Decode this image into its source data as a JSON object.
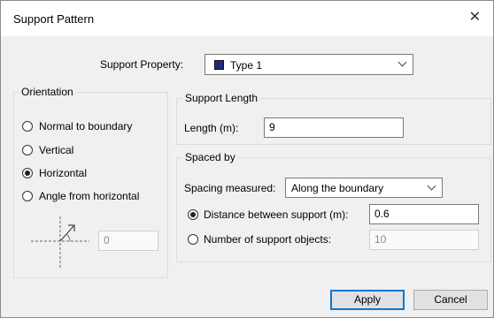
{
  "window": {
    "title": "Support Pattern"
  },
  "support_property": {
    "label": "Support Property:",
    "selected": "Type 1",
    "swatch_color": "#1f2a7a"
  },
  "orientation": {
    "title": "Orientation",
    "options": [
      {
        "label": "Normal to boundary",
        "checked": false
      },
      {
        "label": "Vertical",
        "checked": false
      },
      {
        "label": "Horizontal",
        "checked": true
      },
      {
        "label": "Angle from horizontal",
        "checked": false
      }
    ],
    "angle_value": "0"
  },
  "support_length": {
    "title": "Support Length",
    "length_label": "Length (m):",
    "length_value": "9"
  },
  "spaced_by": {
    "title": "Spaced by",
    "spacing_label": "Spacing measured:",
    "spacing_selected": "Along the boundary",
    "distance_label": "Distance between support (m):",
    "distance_value": "0.6",
    "number_label": "Number of support objects:",
    "number_value": "10",
    "selected_option": "distance"
  },
  "buttons": {
    "apply": "Apply",
    "cancel": "Cancel"
  }
}
